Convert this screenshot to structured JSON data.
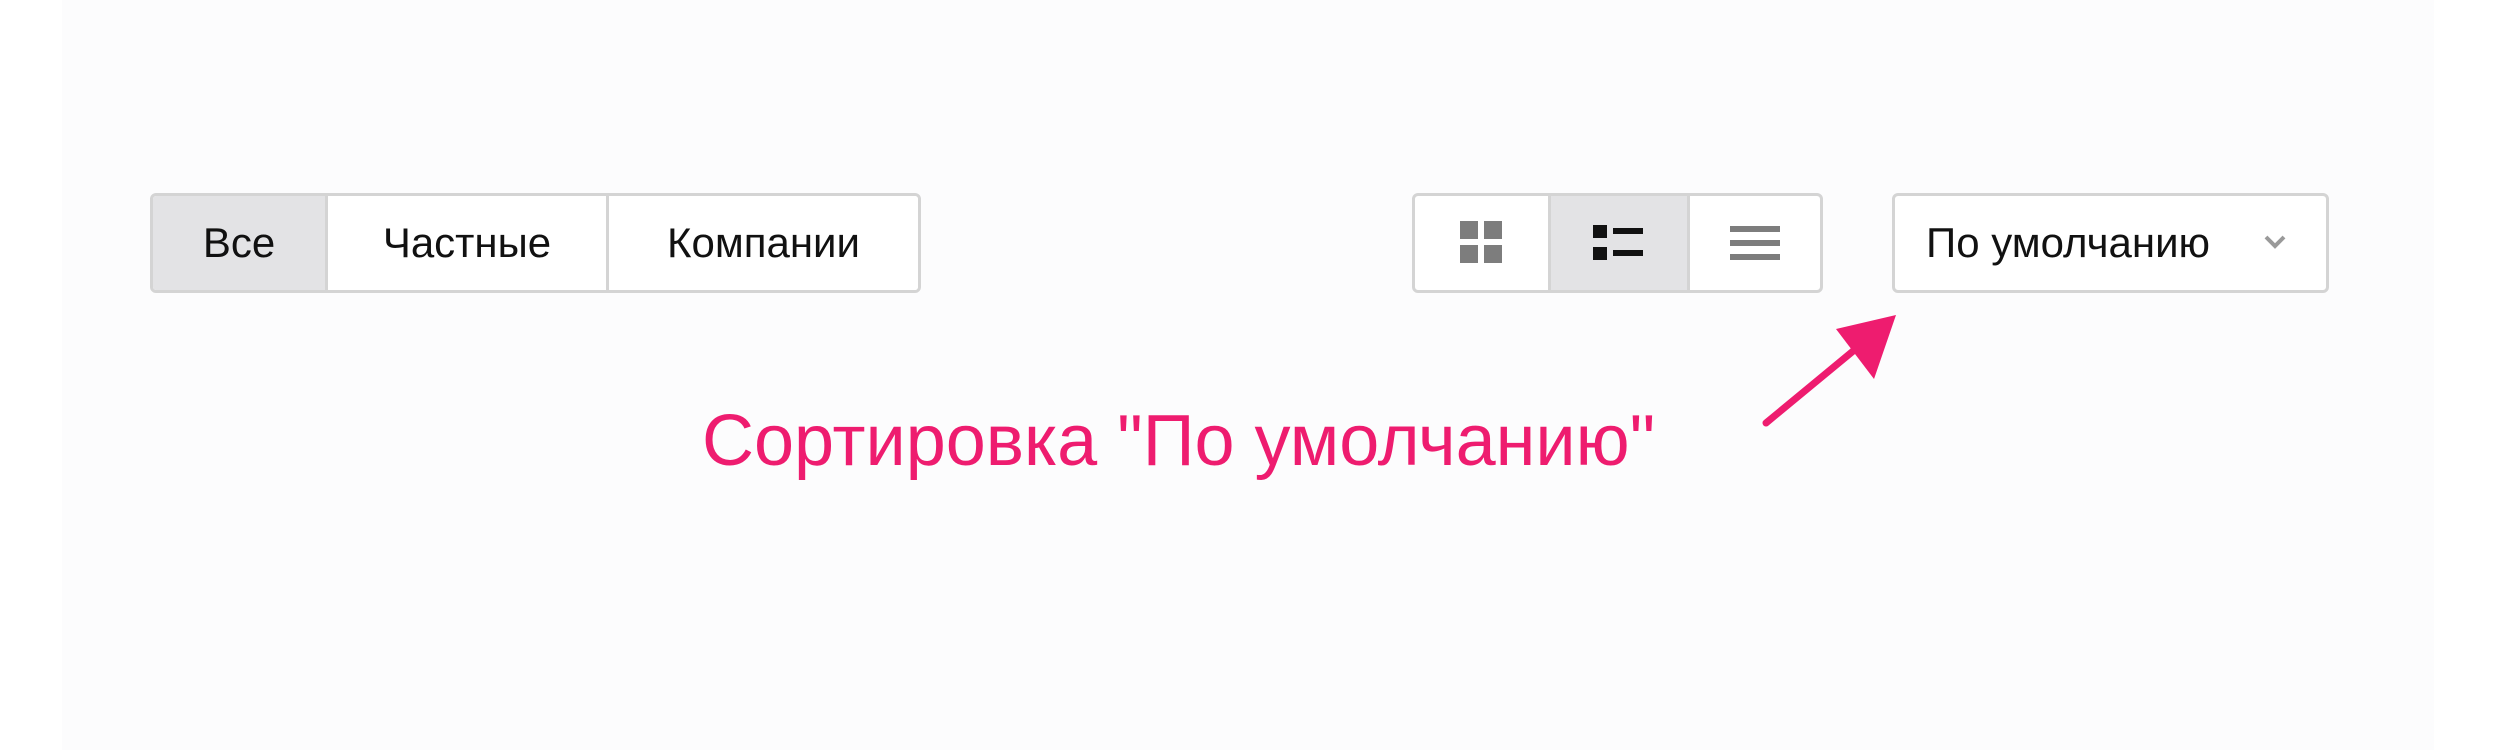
{
  "filters": {
    "items": [
      {
        "label": "Все",
        "active": true
      },
      {
        "label": "Частные",
        "active": false
      },
      {
        "label": "Компании",
        "active": false
      }
    ]
  },
  "view_toggle": {
    "items": [
      {
        "icon": "grid-icon",
        "active": false
      },
      {
        "icon": "list-icon",
        "active": true
      },
      {
        "icon": "rows-icon",
        "active": false
      }
    ]
  },
  "sort": {
    "selected": "По умолчанию",
    "icon": "chevron-down-icon"
  },
  "annotation": {
    "text": "Сортировка \"По умолчанию\"",
    "color": "#ee1c6f"
  },
  "colors": {
    "border": "#d4d4d4",
    "active_bg": "#e3e3e5",
    "icon": "#7d7d7d",
    "icon_active": "#111111"
  }
}
